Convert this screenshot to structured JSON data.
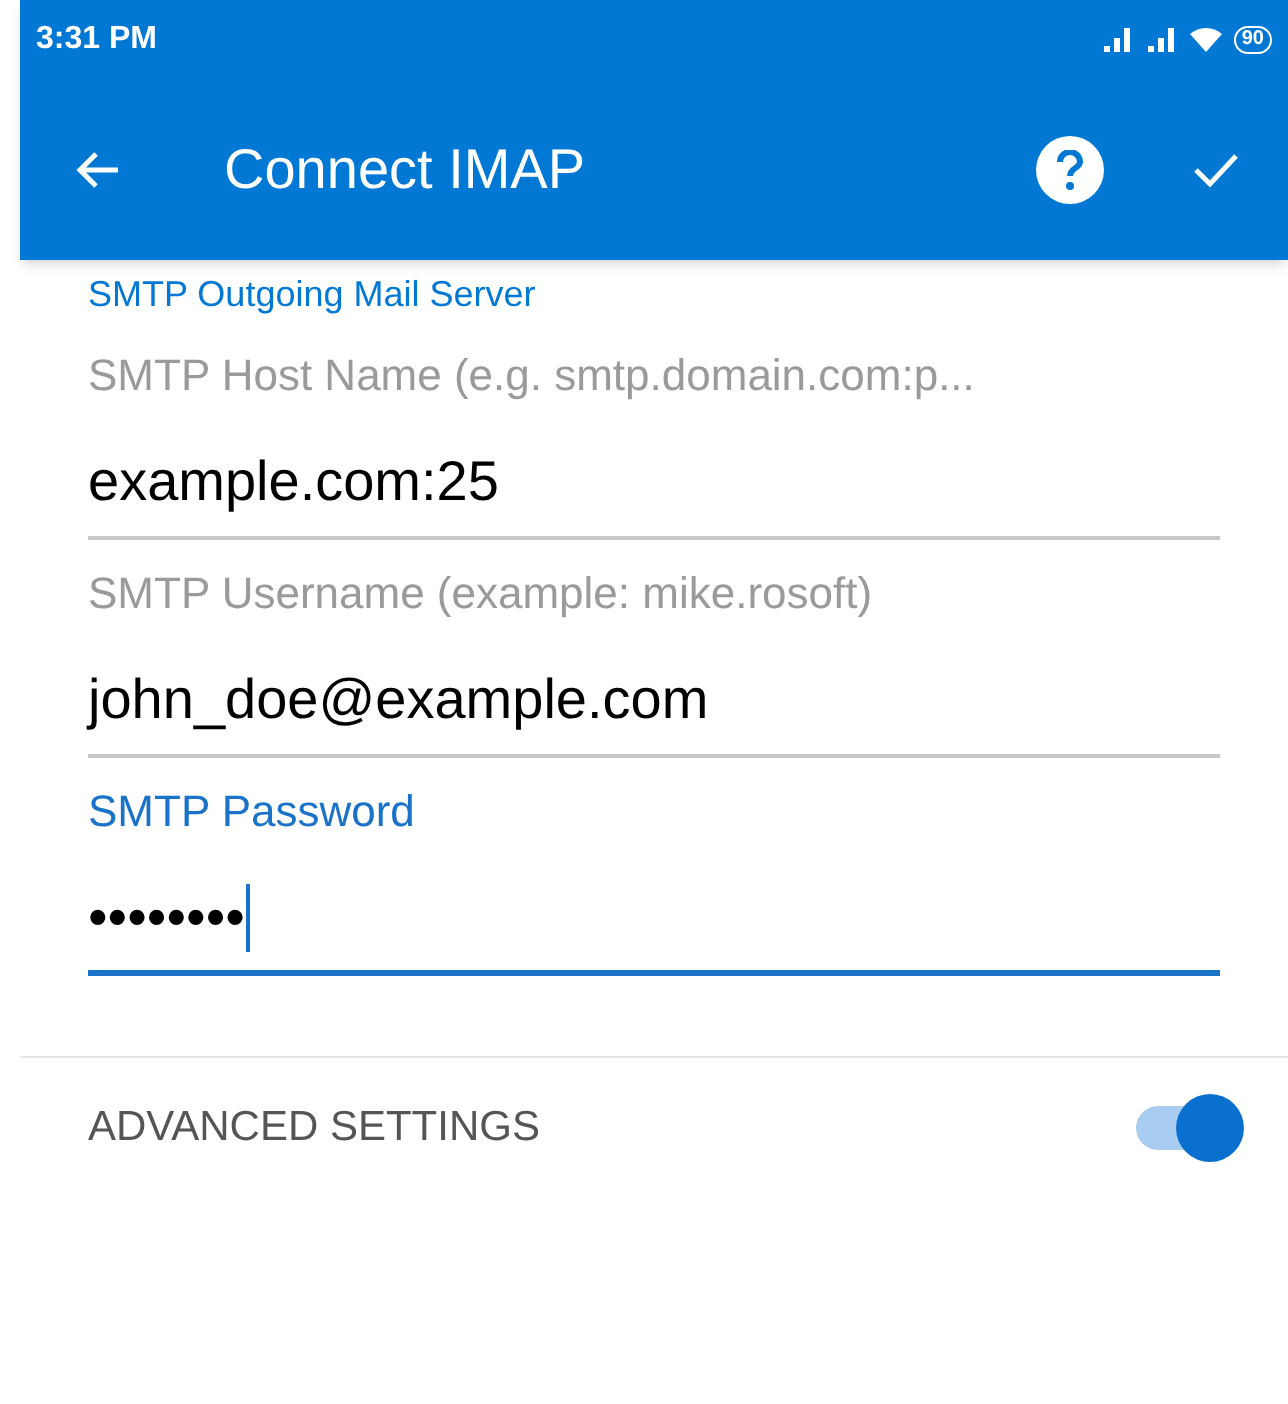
{
  "status_bar": {
    "time": "3:31 PM",
    "battery": "90"
  },
  "toolbar": {
    "title": "Connect IMAP"
  },
  "section": {
    "title": "SMTP Outgoing Mail Server"
  },
  "fields": [
    {
      "label": "SMTP Host Name (e.g. smtp.domain.com:p...",
      "value": "example.com:25",
      "focused": false
    },
    {
      "label": "SMTP Username (example: mike.rosoft)",
      "value": "john_doe@example.com",
      "focused": false
    },
    {
      "label": "SMTP Password",
      "value": "••••••••",
      "focused": true
    }
  ],
  "advanced": {
    "label": "ADVANCED SETTINGS",
    "on": true
  }
}
